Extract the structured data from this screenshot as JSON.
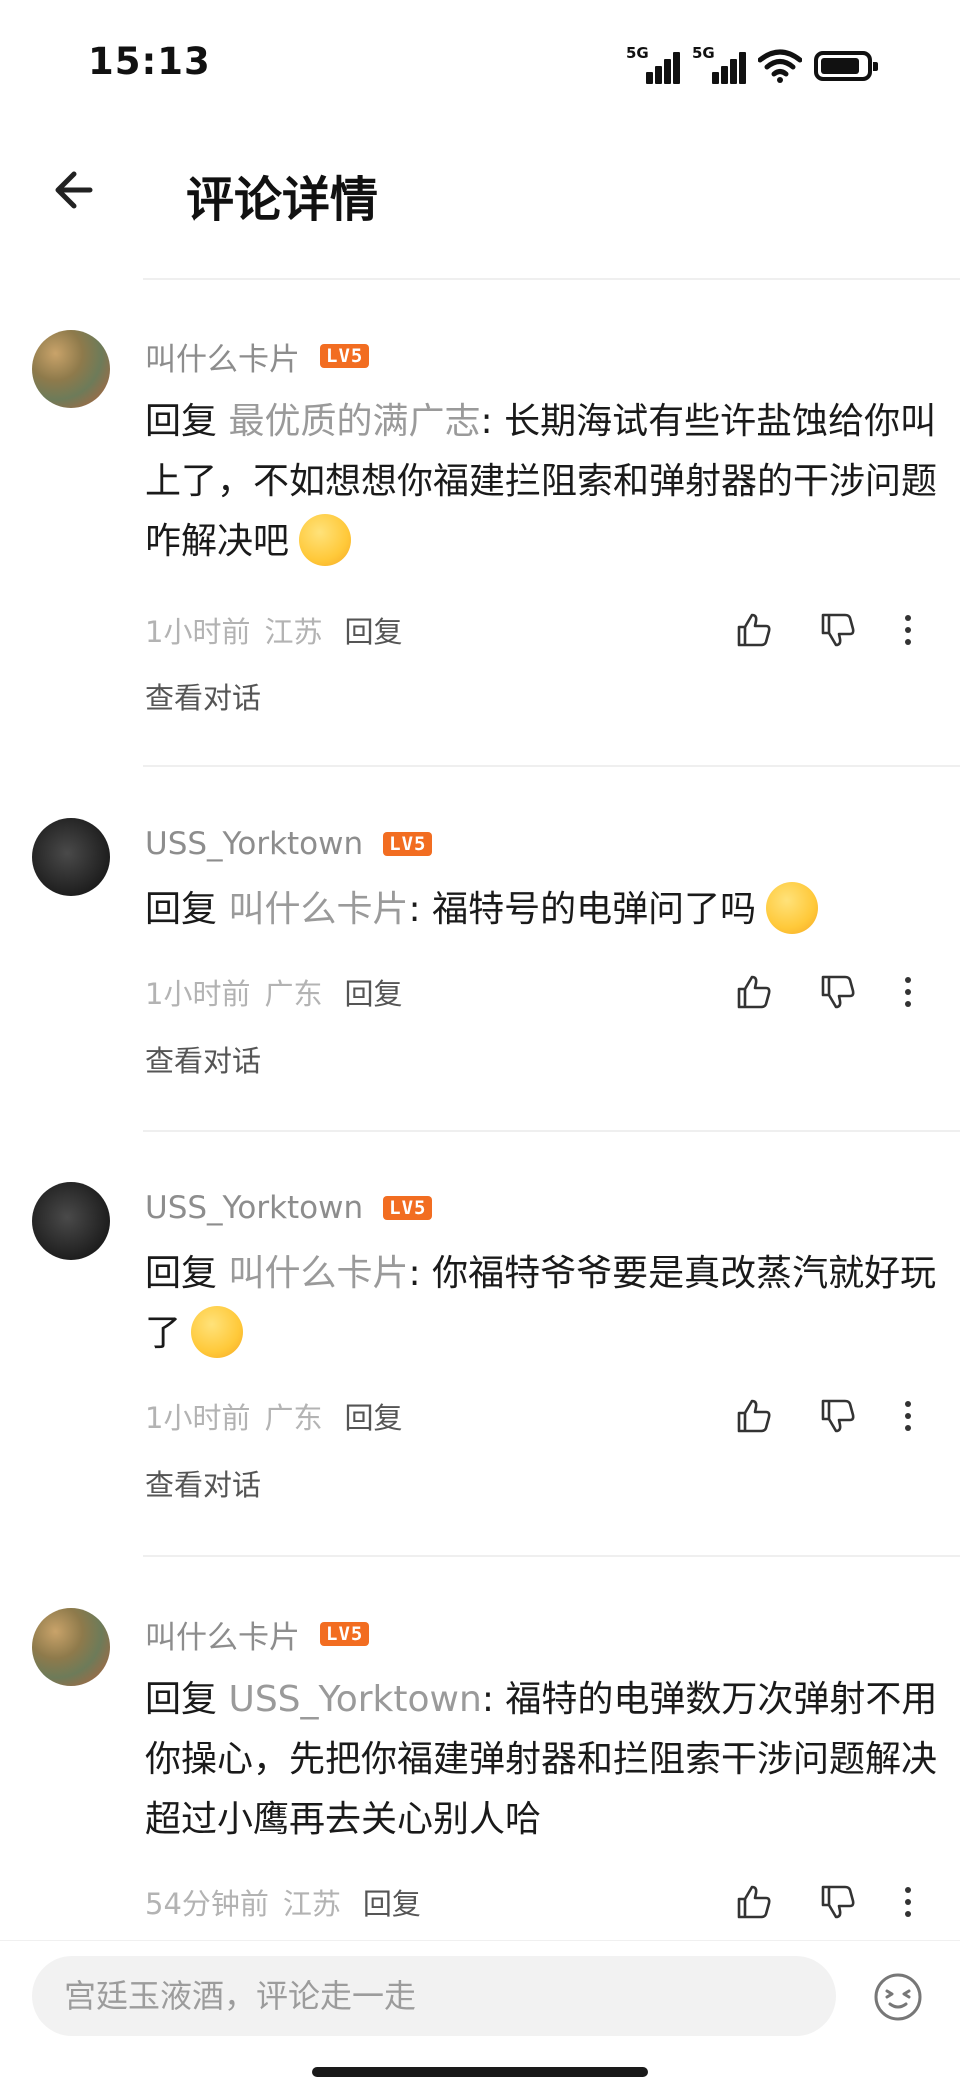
{
  "status_bar": {
    "time": "15:13",
    "signal_1": "5G",
    "signal_2": "5G"
  },
  "header": {
    "title": "评论详情"
  },
  "comments": [
    {
      "username": "叫什么卡片",
      "level": "LV5",
      "prefix": "回复",
      "mention": "最优质的满广志",
      "text": "长期海试有些许盐蚀给你叫上了，不如想想你福建拦阻索和弹射器的干涉问题咋解决吧",
      "emoji": "scared-face-emoji",
      "time": "1小时前",
      "location": "江苏",
      "reply_label": "回复",
      "view_conversation": "查看对话"
    },
    {
      "username": "USS_Yorktown",
      "level": "LV5",
      "prefix": "回复",
      "mention": "叫什么卡片",
      "text": "福特号的电弹问了吗",
      "emoji": "doge-emoji",
      "time": "1小时前",
      "location": "广东",
      "reply_label": "回复",
      "view_conversation": "查看对话"
    },
    {
      "username": "USS_Yorktown",
      "level": "LV5",
      "prefix": "回复",
      "mention": "叫什么卡片",
      "text": "你福特爷爷要是真改蒸汽就好玩了",
      "emoji": "laughing-face-emoji",
      "time": "1小时前",
      "location": "广东",
      "reply_label": "回复",
      "view_conversation": "查看对话"
    },
    {
      "username": "叫什么卡片",
      "level": "LV5",
      "prefix": "回复",
      "mention": "USS_Yorktown",
      "text": "福特的电弹数万次弹射不用你操心，先把你福建弹射器和拦阻索干涉问题解决超过小鹰再去关心别人哈",
      "emoji": "",
      "time": "54分钟前",
      "location": "江苏",
      "reply_label": "回复",
      "view_conversation": ""
    }
  ],
  "bottom_bar": {
    "placeholder": "宫廷玉液酒，评论走一走"
  }
}
